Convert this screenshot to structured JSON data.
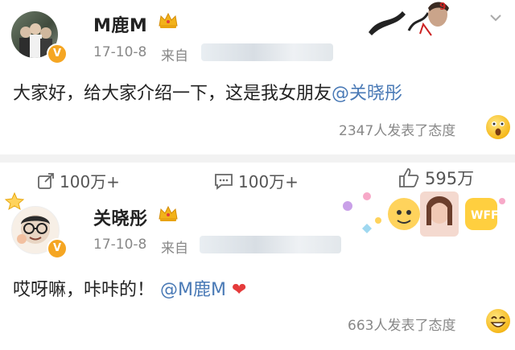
{
  "post1": {
    "username": "M鹿M",
    "date": "17-10-8",
    "source_prefix": "来自",
    "text": "大家好，给大家介绍一下，这是我女朋友",
    "mention": "@关晓彤",
    "reaction_text": "2347人发表了态度"
  },
  "actions": {
    "repost_count": "100万+",
    "comment_count": "100万+",
    "like_count": "595万"
  },
  "post2": {
    "username": "关晓彤",
    "date": "17-10-8",
    "source_prefix": "来自",
    "text": "哎呀嘛，咔咔的！",
    "mention": "@M鹿M",
    "reaction_text": "663人发表了态度"
  },
  "colors": {
    "link": "#4a7ab6",
    "badge": "#f5a623",
    "heart": "#e53b3b"
  },
  "icons": [
    "verified-badge-icon",
    "crown-icon",
    "repost-icon",
    "comment-icon",
    "like-icon",
    "heart-icon",
    "emoji-reaction-icon"
  ]
}
